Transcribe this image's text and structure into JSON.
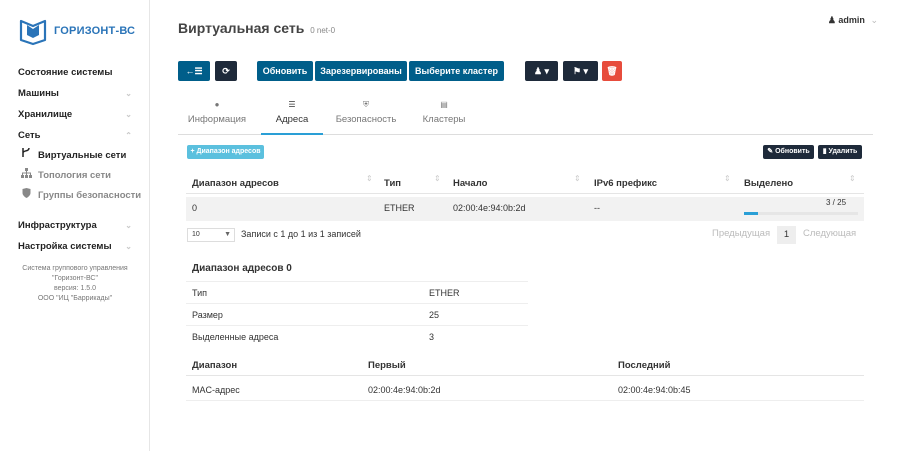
{
  "brand": {
    "name": "ГОРИЗОНТ-ВС",
    "color": "#2a74b8"
  },
  "user": {
    "name": "admin"
  },
  "sidebar": {
    "items": [
      {
        "label": "Состояние системы"
      },
      {
        "label": "Машины"
      },
      {
        "label": "Хранилище"
      },
      {
        "label": "Сеть"
      },
      {
        "label": "Виртуальные сети"
      },
      {
        "label": "Топология сети"
      },
      {
        "label": "Группы безопасности"
      },
      {
        "label": "Инфраструктура"
      },
      {
        "label": "Настройка системы"
      }
    ],
    "info": [
      "Система группового управления",
      "\"Горизонт-ВС\"",
      "версия: 1.5.0",
      "ООО \"ИЦ \"Баррикады\""
    ]
  },
  "page": {
    "title": "Виртуальная сеть",
    "subtitle": "0 net-0"
  },
  "toolbar": {
    "refresh_label": "Обновить",
    "reserved_label": "Зарезервированы",
    "cluster_label": "Выберите кластер"
  },
  "tabs": [
    {
      "label": "Информация",
      "icon": "info-icon"
    },
    {
      "label": "Адреса",
      "icon": "list-icon"
    },
    {
      "label": "Безопасность",
      "icon": "shield-icon"
    },
    {
      "label": "Кластеры",
      "icon": "server-icon"
    }
  ],
  "address_table": {
    "add_range_label": "+ Диапазон адресов",
    "refresh_label": "Обновить",
    "delete_label": "Удалить",
    "columns": [
      "Диапазон адресов",
      "Тип",
      "Начало",
      "IPv6 префикс",
      "Выделено"
    ],
    "rows": [
      {
        "range": "0",
        "type": "ETHER",
        "start": "02:00:4e:94:0b:2d",
        "ipv6": "--",
        "allocated": "3 / 25",
        "allocated_fraction": 0.12
      }
    ],
    "page_length": "10",
    "info": "Записи с 1 до 1 из 1 записей",
    "prev_label": "Предыдущая",
    "current_page": "1",
    "next_label": "Следующая"
  },
  "details": {
    "title": "Диапазон адресов 0",
    "rows": [
      {
        "label": "Тип",
        "value": "ETHER"
      },
      {
        "label": "Размер",
        "value": "25"
      },
      {
        "label": "Выделенные адреса",
        "value": "3"
      }
    ],
    "range_columns": [
      "Диапазон",
      "Первый",
      "Последний"
    ],
    "range_rows": [
      {
        "name": "MAC-адрес",
        "first": "02:00:4e:94:0b:2d",
        "last": "02:00:4e:94:0b:45"
      }
    ]
  },
  "colors": {
    "primary": "#005e8a",
    "dark": "#1e2a3a",
    "danger": "#e74c3c",
    "accent": "#2a9fd6",
    "add": "#5bc0de"
  }
}
